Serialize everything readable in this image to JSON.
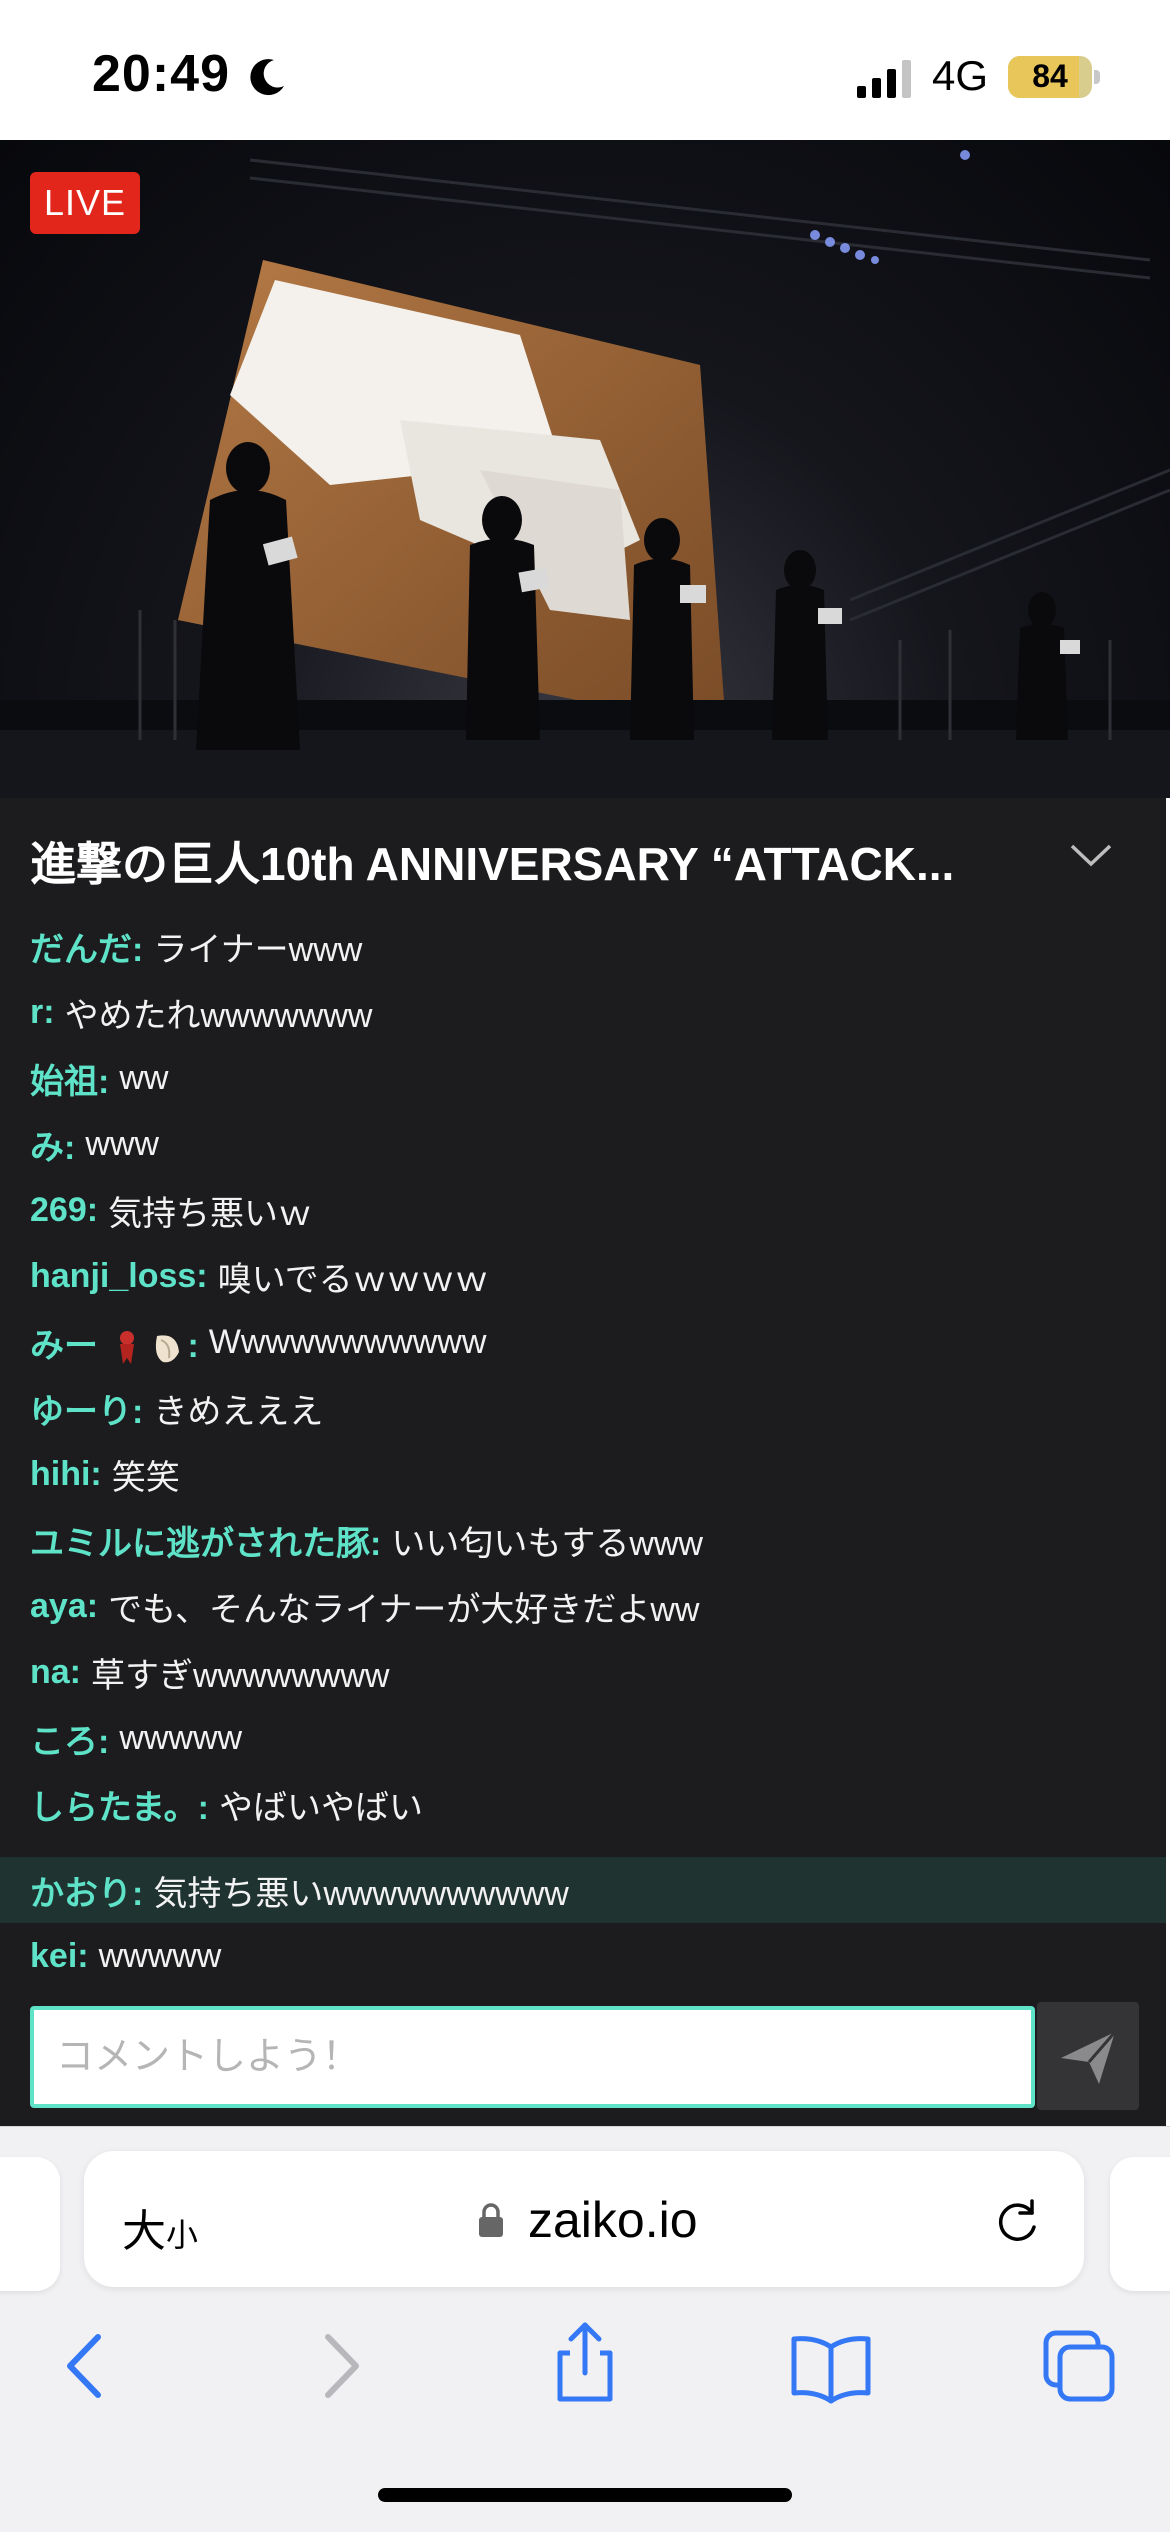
{
  "status_bar": {
    "time": "20:49",
    "network": "4G",
    "battery_level": "84",
    "battery_fraction": 0.84
  },
  "video": {
    "live_label": "LIVE"
  },
  "event": {
    "title": "進撃の巨人10th ANNIVERSARY “ATTACK..."
  },
  "chat": {
    "messages": [
      {
        "user": "だんだ:",
        "text": "ライナーwww"
      },
      {
        "user": "r:",
        "text": "やめたれwwwwwww"
      },
      {
        "user": "始祖:",
        "text": "ww"
      },
      {
        "user": "み:",
        "text": "www"
      },
      {
        "user": "269:",
        "text": "気持ち悪いｗ"
      },
      {
        "user": "hanji_loss:",
        "text": "嗅いでるｗｗｗｗ"
      },
      {
        "user": "みー",
        "user_suffix": ":",
        "user_emoji": [
          "red-scarf-emoji",
          "shell-emoji"
        ],
        "text": "Wwwwwwwwwww"
      },
      {
        "user": "ゆーり:",
        "text": "きめえええ"
      },
      {
        "user": "hihi:",
        "text": "笑笑"
      },
      {
        "user": "ユミルに逃がされた豚:",
        "text": "いい匂いもするwww"
      },
      {
        "user": "aya:",
        "text": "でも、そんなライナーが大好きだよww"
      },
      {
        "user": "na:",
        "text": "草すぎwwwwwwww"
      },
      {
        "user": "ころ:",
        "text": "wwwww"
      },
      {
        "user": "しらたま。:",
        "text": "やばいやばい"
      },
      {
        "user": "かおり:",
        "text": "気持ち悪いwwwwwwwwww",
        "highlighted": true
      },
      {
        "user": "kei:",
        "text": "wwwww"
      }
    ],
    "input_placeholder": "コメントしよう！"
  },
  "browser": {
    "text_size_big": "大",
    "text_size_small": "小",
    "url": "zaiko.io"
  },
  "colors": {
    "accent": "#5ee2c8",
    "live": "#e2261c",
    "chat_bg": "#1c1c1e",
    "ios_blue": "#3478f6"
  },
  "icons": {
    "status": [
      "moon-icon",
      "signal-icon",
      "battery-icon"
    ],
    "toolbar": [
      "back-icon",
      "forward-icon",
      "share-icon",
      "bookmarks-icon",
      "tabs-icon"
    ]
  }
}
